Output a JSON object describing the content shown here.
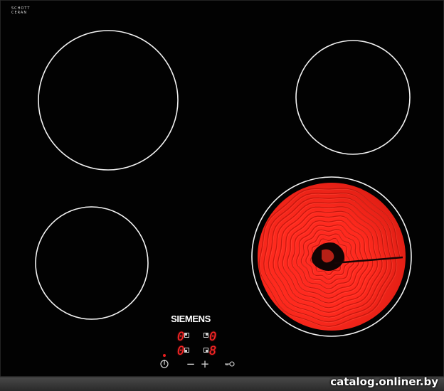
{
  "colors": {
    "glass": "#020202",
    "frame": "#3a3a3a",
    "ring": "#f2f2f2",
    "heated": "#ff2b22",
    "display": "#ff2626",
    "power_dot": "#e81f1f"
  },
  "panel": {
    "maker_line1": "SCHOTT",
    "maker_line2": "CERAN",
    "fine_print": "",
    "brand": "SIEMENS",
    "watermark": "catalog.onliner.by"
  },
  "zones": {
    "back_left": {
      "heating": false
    },
    "back_right": {
      "heating": false
    },
    "front_left": {
      "heating": false
    },
    "front_right": {
      "heating": true
    }
  },
  "controls": {
    "power_icon": "power-icon",
    "minus": "−",
    "plus": "+",
    "lock_icon": "key-lock-icon"
  },
  "displays": [
    {
      "name": "display-back-left",
      "value": "0",
      "indicator": "zone-indicator-icon"
    },
    {
      "name": "display-back-right",
      "value": "0",
      "indicator": "zone-indicator-icon"
    },
    {
      "name": "display-front-left",
      "value": "0",
      "indicator": "zone-indicator-icon"
    },
    {
      "name": "display-front-right",
      "value": "8",
      "indicator": "zone-indicator-icon"
    }
  ]
}
